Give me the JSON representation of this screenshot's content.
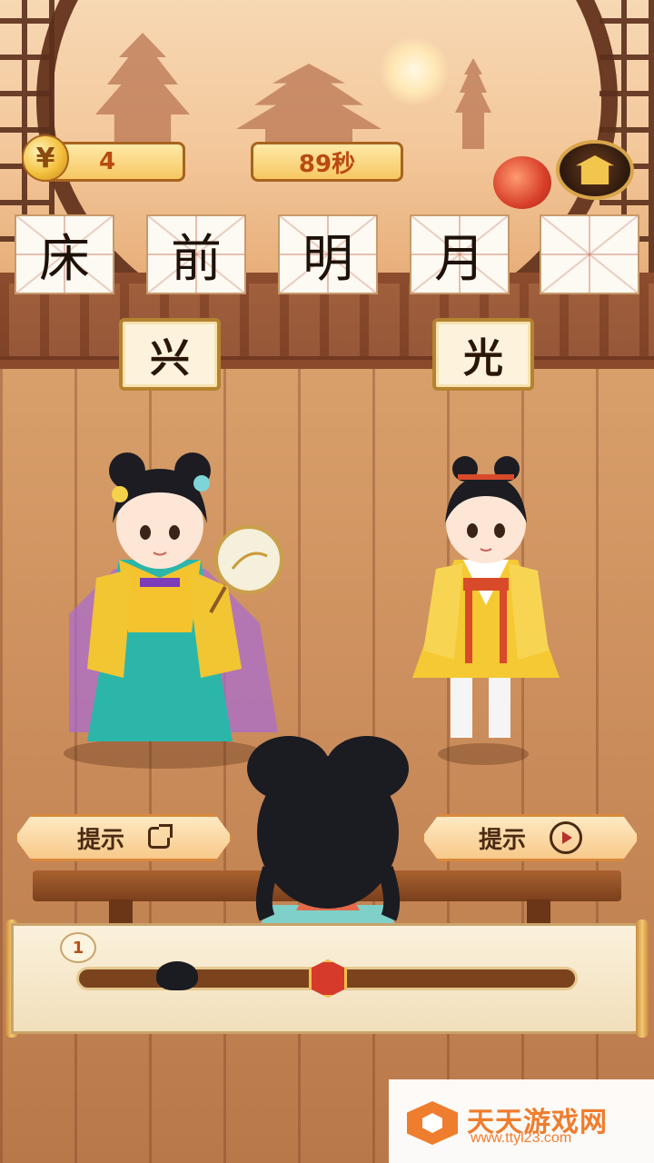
{
  "hud": {
    "coin_icon": "coin-icon",
    "coin_glyph": "¥",
    "coins": "4",
    "timer": "89秒",
    "map_icon": "palace-icon"
  },
  "puzzle": {
    "cells": [
      "床",
      "前",
      "明",
      "月",
      ""
    ],
    "choices": [
      "兴",
      "光"
    ]
  },
  "hints": {
    "share_label": "提示",
    "video_label": "提示"
  },
  "progress": {
    "level": "1",
    "player_position": 0.22,
    "goal_position": 0.52
  },
  "watermark": {
    "title": "天天游戏网",
    "url": "www.ttyl23.com"
  },
  "colors": {
    "accent": "#b84a12",
    "gold": "#f6c763",
    "wood": "#c98b5a"
  }
}
